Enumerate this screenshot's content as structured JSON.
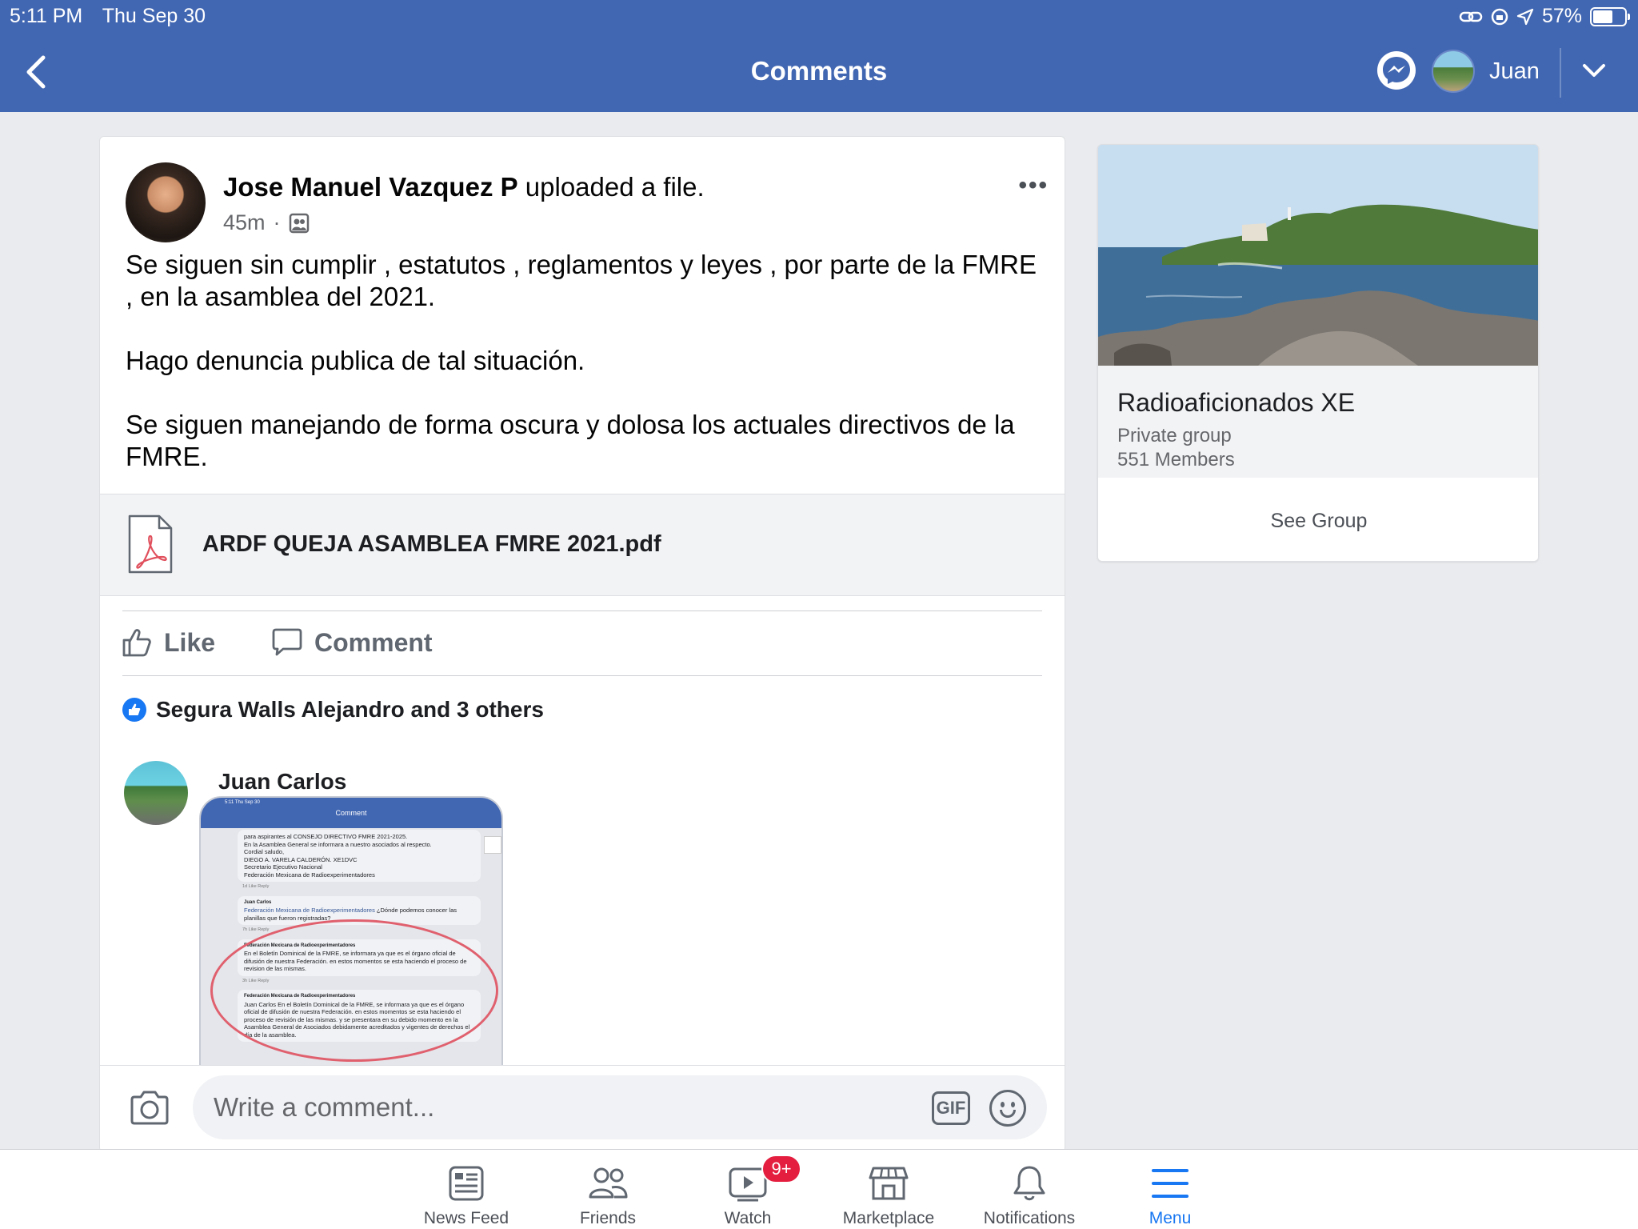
{
  "status_bar": {
    "time": "5:11 PM",
    "date": "Thu Sep 30",
    "battery": "57%"
  },
  "header": {
    "title": "Comments",
    "user_name": "Juan"
  },
  "post": {
    "author": "Jose Manuel Vazquez P",
    "action": " uploaded a file.",
    "time": "45m",
    "paragraphs": [
      "Se siguen sin cumplir , estatutos , reglamentos y leyes , por parte de la FMRE , en la asamblea del 2021.",
      "Hago denuncia publica de tal situación.",
      "Se siguen manejando de forma oscura y dolosa  los actuales directivos de la FMRE."
    ],
    "file_name": "ARDF QUEJA ASAMBLEA FMRE 2021.pdf",
    "like_label": "Like",
    "comment_label": "Comment",
    "reactions_text": "Segura Walls Alejandro and 3 others"
  },
  "comment": {
    "author": "Juan Carlos",
    "screenshot": {
      "status": "5:11  Thu Sep 30",
      "title": "Comment",
      "lines_top": [
        "para aspirantes al CONSEJO DIRECTIVO FMRE 2021-2025.",
        "En la Asamblea General se informara a nuestro asociados al respecto.",
        "Cordial saludo,",
        "DIEGO A. VARELA CALDERÓN. XE1DVC",
        "Secretario Ejecutivo Nacional",
        "Federación Mexicana de Radioexperimentadores"
      ],
      "meta1": "1d   Like   Reply",
      "reply_author": "Juan Carlos",
      "reply_link": "Federación Mexicana de Radioexperimentadores",
      "reply_text": " ¿Dónde podemos conocer las planillas que fueron registradas?",
      "meta2": "7h   Like   Reply",
      "fed_author": "Federación Mexicana de Radioexperimentadores",
      "fed_text1": "En el Boletín Dominical de la FMRE, se informara ya que es el órgano oficial de difusión de nuestra Federación. en estos momentos se esta haciendo el proceso de revision de las mismas.",
      "meta3": "3h   Like   Reply",
      "fed_text2": "Juan Carlos En el Boletín Dominical de la FMRE, se informara ya que es el órgano oficial de difusión de nuestra Federación. en estos momentos se esta haciendo el proceso de revisión de las mismas. y se presentara en su debido momento en la Asamblea General de Asociados debidamente acreditados y vigentes de derechos el día de la asamblea."
    }
  },
  "composer": {
    "placeholder": "Write a comment...",
    "gif_label": "GIF"
  },
  "group": {
    "name": "Radioaficionados XE",
    "privacy": "Private group",
    "members": "551 Members",
    "see_group_label": "See Group"
  },
  "tabs": [
    {
      "label": "News Feed",
      "icon": "news-feed-icon"
    },
    {
      "label": "Friends",
      "icon": "friends-icon"
    },
    {
      "label": "Watch",
      "icon": "watch-icon",
      "badge": "9+"
    },
    {
      "label": "Marketplace",
      "icon": "marketplace-icon"
    },
    {
      "label": "Notifications",
      "icon": "bell-icon"
    },
    {
      "label": "Menu",
      "icon": "menu-icon",
      "active": true
    }
  ],
  "colors": {
    "brand_blue": "#4267b2",
    "accent_blue": "#1877f2",
    "badge_red": "#e41e3f"
  }
}
